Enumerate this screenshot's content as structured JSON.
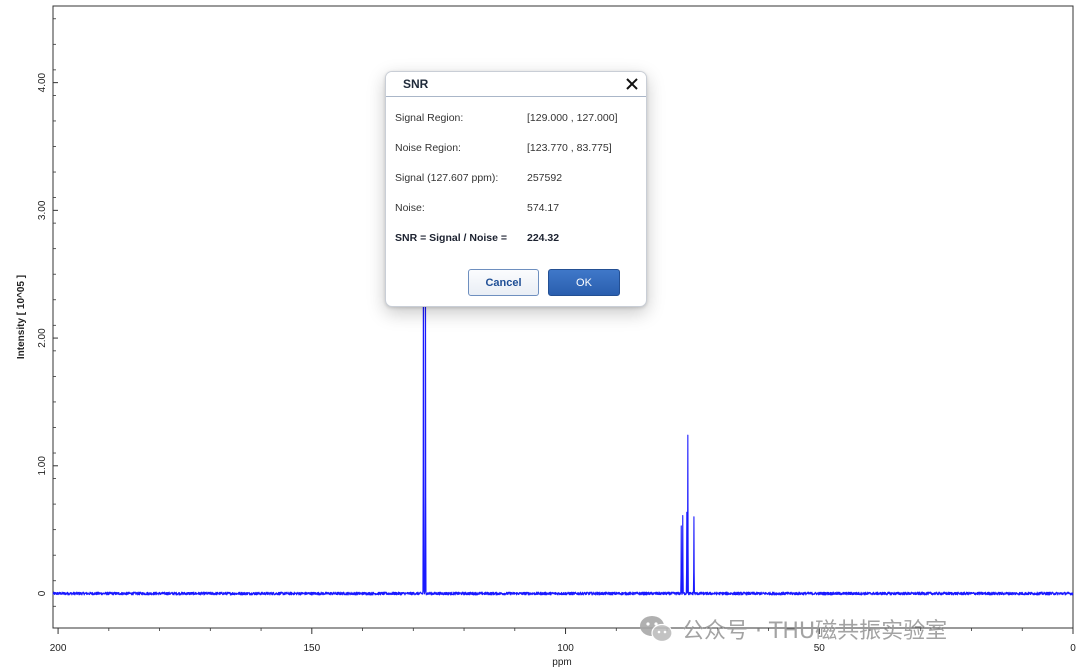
{
  "chart_data": {
    "type": "line",
    "xlabel": "ppm",
    "ylabel": "Intensity [ 10^05 ]",
    "xlim": [
      201,
      0
    ],
    "ylim": [
      -0.27,
      4.6
    ],
    "x_ticks": [
      200,
      150,
      100,
      50,
      0
    ],
    "x_tick_labels": [
      "200",
      "150",
      "100",
      "50",
      "0"
    ],
    "y_ticks": [
      0,
      1,
      2,
      3,
      4
    ],
    "y_tick_labels": [
      "0",
      "1.00",
      "2.00",
      "3.00",
      "4.00"
    ],
    "grid": false,
    "series": [
      {
        "color": "#1a1aff",
        "peaks": [
          {
            "x": 128.0,
            "y": 3.3
          },
          {
            "x": 127.6,
            "y": 2.6
          },
          {
            "x": 76.9,
            "y": 0.6
          },
          {
            "x": 77.2,
            "y": 0.52
          },
          {
            "x": 75.9,
            "y": 1.23
          },
          {
            "x": 76.1,
            "y": 0.64
          },
          {
            "x": 74.7,
            "y": 0.6
          }
        ]
      }
    ]
  },
  "dialog": {
    "title": "SNR",
    "rows": [
      {
        "label": "Signal Region:",
        "value": "[129.000 , 127.000]"
      },
      {
        "label": "Noise Region:",
        "value": "[123.770 , 83.775]"
      },
      {
        "label": "Signal (127.607 ppm):",
        "value": "257592"
      },
      {
        "label": "Noise:",
        "value": "574.17"
      },
      {
        "label": "SNR = Signal / Noise =",
        "value": "224.32"
      }
    ],
    "cancel_label": "Cancel",
    "ok_label": "OK"
  },
  "watermark": {
    "text": "公众号 · THU磁共振实验室"
  },
  "colors": {
    "trace": "#1a1aff",
    "ok_button": "#2f66b8",
    "cancel_text": "#1f4f96"
  }
}
